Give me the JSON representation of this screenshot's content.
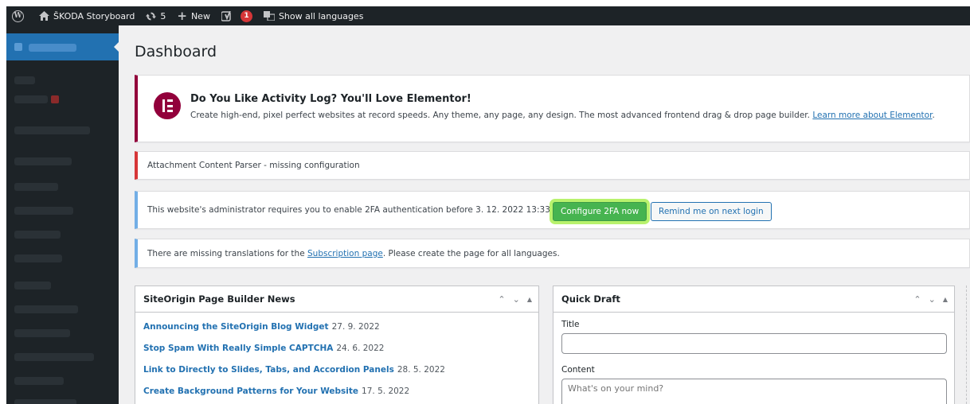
{
  "adminbar": {
    "site_name": "ŠKODA Storyboard",
    "updates_count": "5",
    "new_label": "New",
    "yoast_count": "1",
    "languages_label": "Show all languages"
  },
  "page": {
    "title": "Dashboard"
  },
  "notices": {
    "elementor": {
      "title": "Do You Like Activity Log? You'll Love Elementor!",
      "text": "Create high-end, pixel perfect websites at record speeds. Any theme, any page, any design. The most advanced frontend drag & drop page builder.",
      "link": "Learn more about Elementor"
    },
    "parser": {
      "text": "Attachment Content Parser - missing configuration"
    },
    "twofa": {
      "text": "This website's administrator requires you to enable 2FA authentication before 3. 12. 2022 13:33",
      "configure_label": "Configure 2FA now",
      "remind_label": "Remind me on next login"
    },
    "translations": {
      "before": "There are missing translations for the",
      "link": "Subscription page",
      "after": ". Please create the page for all languages."
    }
  },
  "news_widget": {
    "title": "SiteOrigin Page Builder News",
    "items": [
      {
        "title": "Announcing the SiteOrigin Blog Widget",
        "date": "27. 9. 2022"
      },
      {
        "title": "Stop Spam With Really Simple CAPTCHA",
        "date": "24. 6. 2022"
      },
      {
        "title": "Link to Directly to Slides, Tabs, and Accordion Panels",
        "date": "28. 5. 2022"
      },
      {
        "title": "Create Background Patterns for Your Website",
        "date": "17. 5. 2022"
      }
    ]
  },
  "quick_draft": {
    "title": "Quick Draft",
    "title_label": "Title",
    "title_value": "",
    "content_label": "Content",
    "content_placeholder": "What's on your mind?"
  },
  "colors": {
    "adminbar_bg": "#1d2327",
    "accent_blue": "#2271b1",
    "configure_green": "#46b450",
    "highlight": "#b8f26d",
    "elementor": "#92003b",
    "error_red": "#d63638"
  }
}
